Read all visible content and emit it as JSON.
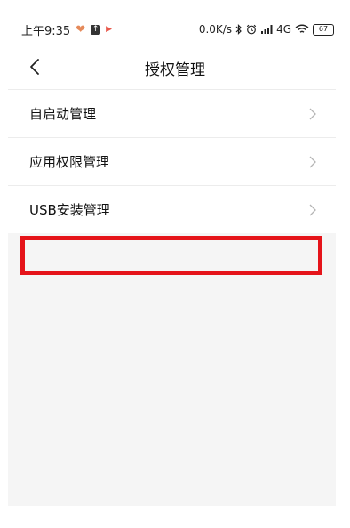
{
  "status_bar": {
    "time": "上午9:35",
    "network_speed": "0.0K/s",
    "network_type": "4G",
    "battery": "67",
    "icons": [
      "heart-icon",
      "upload-icon",
      "play-icon",
      "bluetooth-icon",
      "alarm-icon",
      "signal-icon",
      "wifi-icon",
      "battery-icon"
    ]
  },
  "header": {
    "title": "授权管理",
    "back_icon": "chevron-left-icon"
  },
  "list": {
    "items": [
      {
        "label": "自启动管理",
        "icon": "chevron-right-icon"
      },
      {
        "label": "应用权限管理",
        "icon": "chevron-right-icon"
      },
      {
        "label": "USB安装管理",
        "icon": "chevron-right-icon"
      }
    ]
  },
  "colors": {
    "highlight": "#e5141a",
    "background_gray": "#f5f5f5",
    "divider": "#ececec"
  }
}
